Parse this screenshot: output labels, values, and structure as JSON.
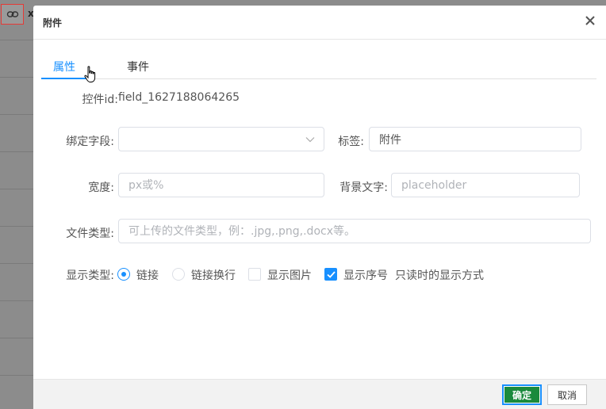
{
  "background": {
    "link_icon": "link-icon",
    "close_glyph": "x"
  },
  "modal": {
    "title": "附件",
    "close_icon": "close-icon"
  },
  "tabs": [
    {
      "label": "属性",
      "active": true
    },
    {
      "label": "事件",
      "active": false
    }
  ],
  "form": {
    "control_id_label": "控件id:",
    "control_id_value": "field_1627188064265",
    "bind_field_label": "绑定字段:",
    "bind_field_value": "",
    "tag_label": "标签:",
    "tag_value": "附件",
    "width_label": "宽度:",
    "width_placeholder": "px或%",
    "bg_text_label": "背景文字:",
    "bg_text_placeholder": "placeholder",
    "file_type_label": "文件类型:",
    "file_type_placeholder": "可上传的文件类型，例：.jpg,.png,.docx等。",
    "display_type_label": "显示类型:",
    "display_options": [
      {
        "label": "链接",
        "kind": "radio",
        "checked": true
      },
      {
        "label": "链接换行",
        "kind": "radio",
        "checked": false
      },
      {
        "label": "显示图片",
        "kind": "radio",
        "checked": false
      }
    ],
    "show_index_label": "显示序号",
    "show_index_checked": true,
    "show_index_hint": "只读时的显示方式"
  },
  "footer": {
    "ok_label": "确定",
    "cancel_label": "取消"
  },
  "colors": {
    "accent": "#1890ff",
    "ok_button": "#1a8a3c"
  }
}
